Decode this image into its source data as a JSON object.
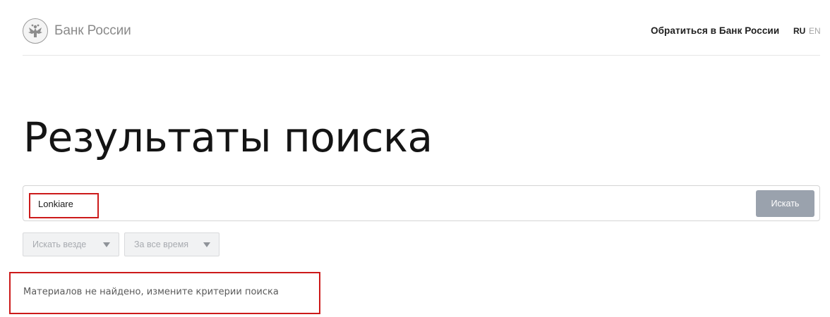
{
  "header": {
    "logo_text": "Банк России",
    "logo_icon": "double-headed-eagle-icon",
    "contact_link": "Обратиться в Банк России",
    "languages": [
      {
        "code": "RU",
        "active": true
      },
      {
        "code": "EN",
        "active": false
      }
    ]
  },
  "main": {
    "title": "Результаты поиска",
    "search": {
      "value": "Lonkiare",
      "button_label": "Искать"
    },
    "filters": [
      {
        "label": "Искать везде"
      },
      {
        "label": "За все время"
      }
    ],
    "empty_message": "Материалов не найдено, измените критерии поиска"
  },
  "colors": {
    "highlight": "#cc1a1a",
    "button_bg": "#9aa2ad",
    "lang_inactive": "#a5a5a5"
  }
}
